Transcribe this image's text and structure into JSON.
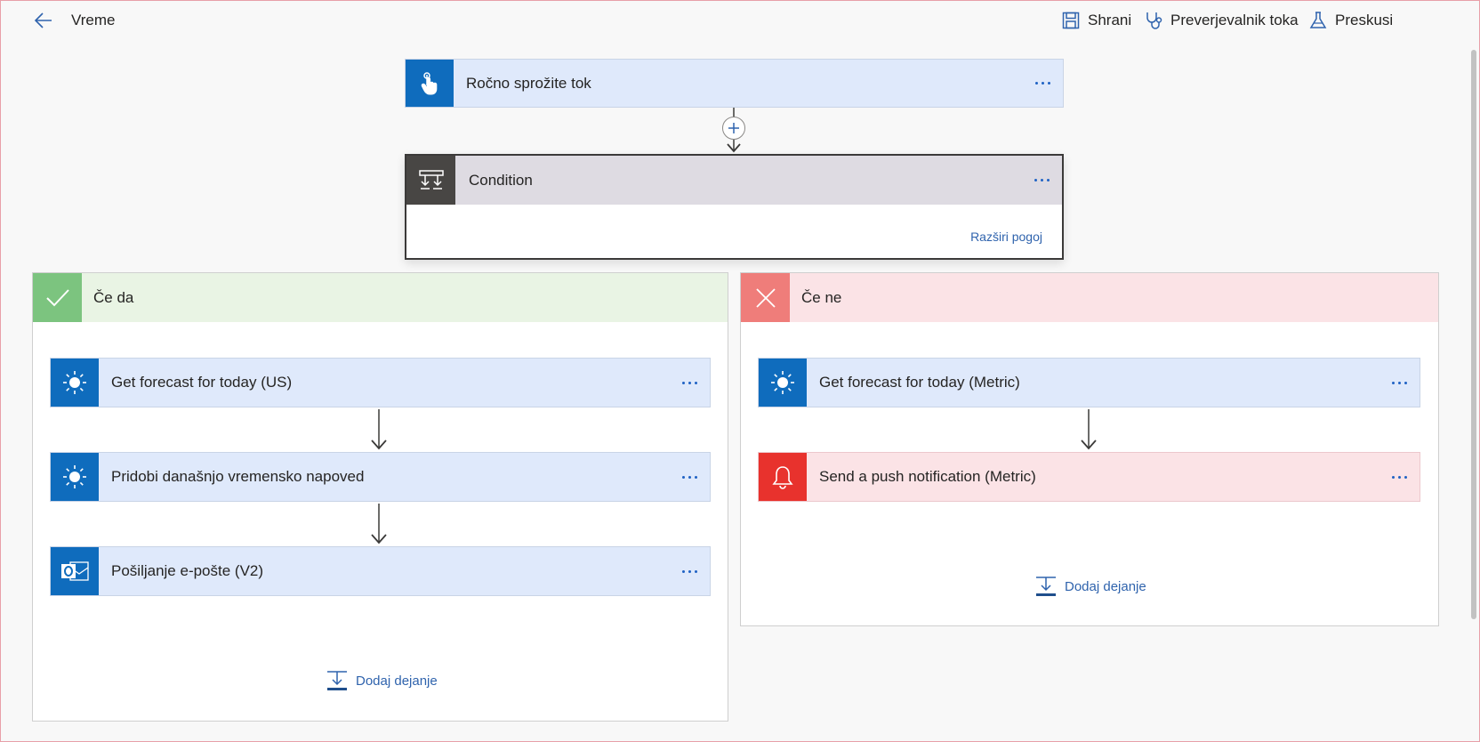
{
  "header": {
    "title": "Vreme",
    "save_label": "Shrani",
    "checker_label": "Preverjevalnik toka",
    "test_label": "Preskusi"
  },
  "trigger": {
    "label": "Ročno sprožite tok"
  },
  "condition": {
    "label": "Condition",
    "expand_label": "Razširi pogoj"
  },
  "branch_yes": {
    "label": "Če da",
    "actions": [
      {
        "label": "Get forecast for today (US)"
      },
      {
        "label": "Pridobi današnjo vremensko napoved"
      },
      {
        "label": "Pošiljanje e-pošte (V2)"
      }
    ],
    "add_action_label": "Dodaj dejanje"
  },
  "branch_no": {
    "label": "Če ne",
    "actions": [
      {
        "label": "Get forecast for today (Metric)"
      },
      {
        "label": "Send a push notification (Metric)"
      }
    ],
    "add_action_label": "Dodaj dejanje"
  },
  "colors": {
    "action_blue": "#0f6cbd",
    "card_bg": "#dfe9fb",
    "yes_green": "#7cc47f",
    "yes_header": "#e9f4e4",
    "no_red": "#ef7d7a",
    "no_header": "#fbe3e6",
    "notification_red": "#e8322d",
    "link_blue": "#2f63ad"
  }
}
